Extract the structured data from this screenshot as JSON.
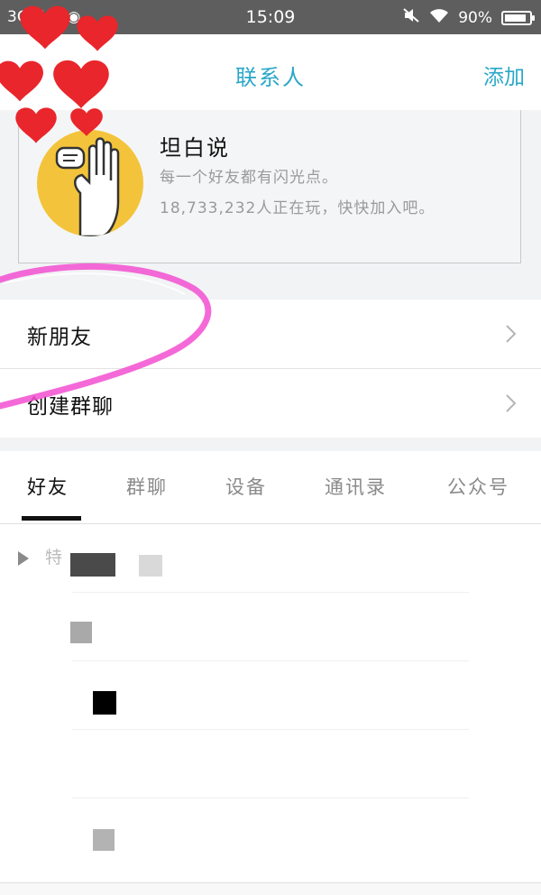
{
  "status_bar": {
    "left_text": "3G K/s",
    "time": "15:09",
    "battery_text": "90%",
    "battery_level": 0.9
  },
  "header": {
    "title": "联系人",
    "add_label": "添加"
  },
  "promo": {
    "title": "坦白说",
    "line1": "每一个好友都有闪光点。",
    "line2": "18,733,232人正在玩，快快加入吧。"
  },
  "rows": {
    "new_friends": "新朋友",
    "create_group_chat": "创建群聊"
  },
  "tabs": [
    {
      "label": "好友",
      "active": true
    },
    {
      "label": "群聊",
      "active": false
    },
    {
      "label": "设备",
      "active": false
    },
    {
      "label": "通讯录",
      "active": false
    },
    {
      "label": "公众号",
      "active": false
    }
  ],
  "friend_list": {
    "group_label": "特"
  },
  "colors": {
    "accent": "#2aa7c8",
    "heart": "#e8262b",
    "scribble": "#f24fd0"
  }
}
